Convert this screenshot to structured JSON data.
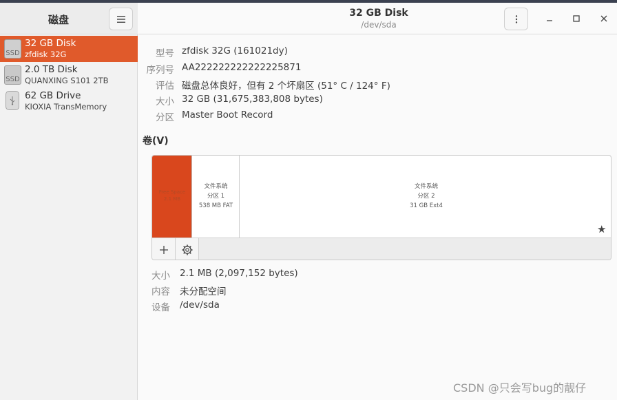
{
  "sidebar": {
    "title": "磁盘",
    "menu_icon": "hamburger-icon",
    "devices": [
      {
        "name": "32 GB Disk",
        "sub": "zfdisk 32G",
        "icon": "SSD",
        "selected": true
      },
      {
        "name": "2.0 TB Disk",
        "sub": "QUANXING S101 2TB",
        "icon": "SSD",
        "selected": false
      },
      {
        "name": "62 GB Drive",
        "sub": "KIOXIA TransMemory",
        "icon": "usb-drive-icon",
        "selected": false
      }
    ]
  },
  "header": {
    "title": "32 GB Disk",
    "subtitle": "/dev/sda",
    "menu_icon": "kebab-icon",
    "controls": [
      "minimize-icon",
      "maximize-icon",
      "close-icon"
    ]
  },
  "info": {
    "rows": [
      {
        "label": "型号",
        "value": "zfdisk 32G (161021dy)"
      },
      {
        "label": "序列号",
        "value": "AA222222222222225871"
      },
      {
        "label": "评估",
        "value": "磁盘总体良好，但有 2 个坏扇区 (51° C / 124° F)"
      },
      {
        "label": "大小",
        "value": "32 GB (31,675,383,808 bytes)"
      },
      {
        "label": "分区",
        "value": "Master Boot Record"
      }
    ]
  },
  "volumes": {
    "title": "卷(V)",
    "free_space_label": [
      "Free Space",
      "2.1 MB"
    ],
    "partitions": [
      {
        "lines": [
          "文件系统",
          "分区 1",
          "538 MB FAT"
        ]
      },
      {
        "lines": [
          "文件系统",
          "分区 2",
          "31 GB Ext4"
        ]
      }
    ],
    "toolbar": [
      "add-icon",
      "gear-icon"
    ],
    "star_icon": "star-icon"
  },
  "selected_volume": {
    "rows": [
      {
        "label": "大小",
        "value": "2.1 MB (2,097,152 bytes)"
      },
      {
        "label": "内容",
        "value": "未分配空间"
      },
      {
        "label": "设备",
        "value": "/dev/sda"
      }
    ]
  },
  "watermark": "CSDN @只会写bug的靓仔",
  "colors": {
    "accent": "#e05a2b",
    "free_space": "#d9471d"
  }
}
